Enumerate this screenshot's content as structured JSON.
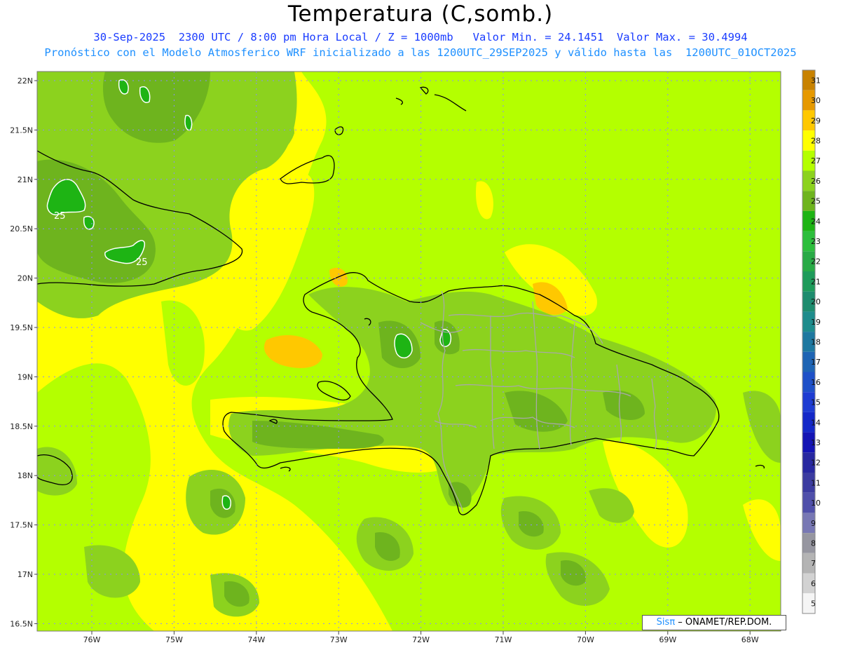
{
  "title": "Temperatura (C,somb.)",
  "subtitle_1": "30-Sep-2025  2300 UTC / 8:00 pm Hora Local / Z = 1000mb   Valor Min. = 24.1451  Valor Max. = 30.4994",
  "subtitle_2": "Pronóstico con el Modelo Atmosferico WRF inicializado a las 1200UTC_29SEP2025 y válido hasta las  1200UTC_01OCT2025",
  "lat_labels": [
    "22N",
    "21.5N",
    "21N",
    "20.5N",
    "20N",
    "19.5N",
    "19N",
    "18.5N",
    "18N",
    "17.5N",
    "17N",
    "16.5N"
  ],
  "lon_labels": [
    "76W",
    "75W",
    "74W",
    "73W",
    "72W",
    "71W",
    "70W",
    "69W",
    "68W"
  ],
  "contour_labels": [
    "25",
    "25"
  ],
  "colorbar": {
    "labels": [
      "31",
      "30",
      "29",
      "28",
      "27",
      "26",
      "25",
      "24",
      "23",
      "22",
      "21",
      "20",
      "19",
      "18",
      "17",
      "16",
      "15",
      "14",
      "13",
      "12",
      "11",
      "10",
      "9",
      "8",
      "7",
      "6",
      "5"
    ],
    "colors": [
      "#c88200",
      "#e69900",
      "#ffc800",
      "#ffff00",
      "#b4ff00",
      "#8cd21e",
      "#6eb41e",
      "#1eb414",
      "#2cbe3c",
      "#28aa46",
      "#1e9b5a",
      "#1e8c6e",
      "#1e8c8c",
      "#1e78a0",
      "#1e64b4",
      "#1e50c8",
      "#1e3cd2",
      "#1428c8",
      "#1414b4",
      "#2828a0",
      "#3c3ca0",
      "#5050aa",
      "#7878b4",
      "#9696a0",
      "#b4b4b4",
      "#d2d2d2",
      "#f5f5f5"
    ]
  },
  "credit": {
    "prefix": "Sis",
    "pi": "π",
    "text": "– ONAMET/REP.DOM."
  },
  "colors": {
    "yellow": "#ffff00",
    "lime": "#b4ff00",
    "light_green": "#8cd21e",
    "mid_green": "#6eb41e",
    "dark_green": "#1eb414",
    "orange": "#ffc800",
    "dark_orange": "#e69900",
    "grid": "#8a8aff"
  }
}
